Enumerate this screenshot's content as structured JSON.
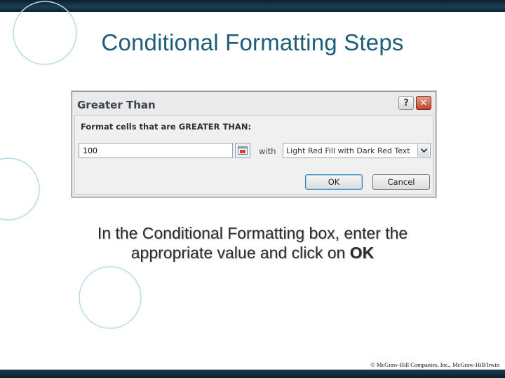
{
  "slide": {
    "title": "Conditional Formatting Steps",
    "caption_main": "In the Conditional Formatting box, enter the appropriate value and click on",
    "caption_bold": "OK",
    "copyright": "© McGraw-Hill Companies, Inc., McGraw-Hill/Irwin"
  },
  "dialog": {
    "title": "Greater Than",
    "help_label": "?",
    "close_label": "✕",
    "prompt": "Format cells that are GREATER THAN:",
    "value": "100",
    "with_label": "with",
    "format_selected": "Light Red Fill with Dark Red Text",
    "ok_label": "OK",
    "cancel_label": "Cancel"
  },
  "icons": {
    "collapse": "range-select-icon",
    "dropdown": "chevron-down-icon",
    "help": "help-icon",
    "close": "close-icon"
  },
  "colors": {
    "title": "#1d5d78",
    "bar": "#0e2232",
    "circle_stroke": "#b7dbe9",
    "close_button": "#c1432a"
  }
}
